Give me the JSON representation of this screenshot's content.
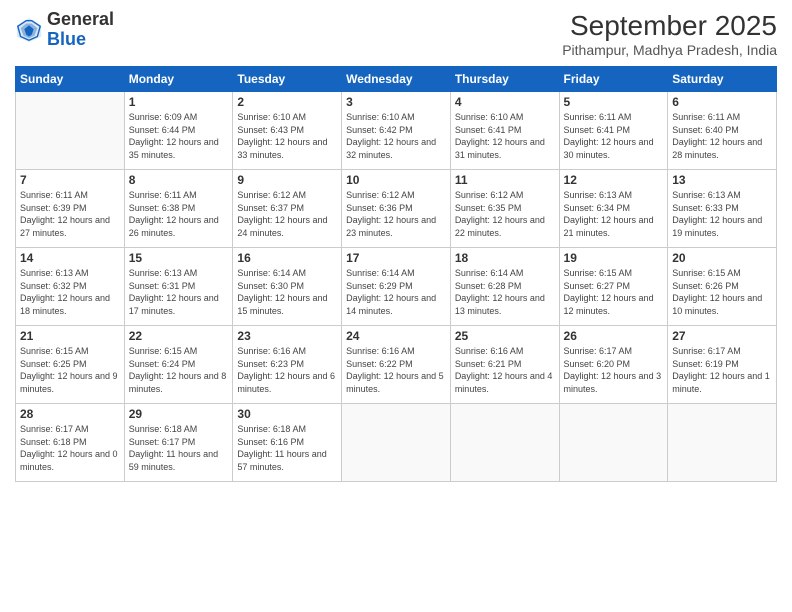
{
  "logo": {
    "general": "General",
    "blue": "Blue"
  },
  "header": {
    "month": "September 2025",
    "location": "Pithampur, Madhya Pradesh, India"
  },
  "days_of_week": [
    "Sunday",
    "Monday",
    "Tuesday",
    "Wednesday",
    "Thursday",
    "Friday",
    "Saturday"
  ],
  "weeks": [
    [
      {
        "day": "",
        "info": ""
      },
      {
        "day": "1",
        "info": "Sunrise: 6:09 AM\nSunset: 6:44 PM\nDaylight: 12 hours\nand 35 minutes."
      },
      {
        "day": "2",
        "info": "Sunrise: 6:10 AM\nSunset: 6:43 PM\nDaylight: 12 hours\nand 33 minutes."
      },
      {
        "day": "3",
        "info": "Sunrise: 6:10 AM\nSunset: 6:42 PM\nDaylight: 12 hours\nand 32 minutes."
      },
      {
        "day": "4",
        "info": "Sunrise: 6:10 AM\nSunset: 6:41 PM\nDaylight: 12 hours\nand 31 minutes."
      },
      {
        "day": "5",
        "info": "Sunrise: 6:11 AM\nSunset: 6:41 PM\nDaylight: 12 hours\nand 30 minutes."
      },
      {
        "day": "6",
        "info": "Sunrise: 6:11 AM\nSunset: 6:40 PM\nDaylight: 12 hours\nand 28 minutes."
      }
    ],
    [
      {
        "day": "7",
        "info": "Sunrise: 6:11 AM\nSunset: 6:39 PM\nDaylight: 12 hours\nand 27 minutes."
      },
      {
        "day": "8",
        "info": "Sunrise: 6:11 AM\nSunset: 6:38 PM\nDaylight: 12 hours\nand 26 minutes."
      },
      {
        "day": "9",
        "info": "Sunrise: 6:12 AM\nSunset: 6:37 PM\nDaylight: 12 hours\nand 24 minutes."
      },
      {
        "day": "10",
        "info": "Sunrise: 6:12 AM\nSunset: 6:36 PM\nDaylight: 12 hours\nand 23 minutes."
      },
      {
        "day": "11",
        "info": "Sunrise: 6:12 AM\nSunset: 6:35 PM\nDaylight: 12 hours\nand 22 minutes."
      },
      {
        "day": "12",
        "info": "Sunrise: 6:13 AM\nSunset: 6:34 PM\nDaylight: 12 hours\nand 21 minutes."
      },
      {
        "day": "13",
        "info": "Sunrise: 6:13 AM\nSunset: 6:33 PM\nDaylight: 12 hours\nand 19 minutes."
      }
    ],
    [
      {
        "day": "14",
        "info": "Sunrise: 6:13 AM\nSunset: 6:32 PM\nDaylight: 12 hours\nand 18 minutes."
      },
      {
        "day": "15",
        "info": "Sunrise: 6:13 AM\nSunset: 6:31 PM\nDaylight: 12 hours\nand 17 minutes."
      },
      {
        "day": "16",
        "info": "Sunrise: 6:14 AM\nSunset: 6:30 PM\nDaylight: 12 hours\nand 15 minutes."
      },
      {
        "day": "17",
        "info": "Sunrise: 6:14 AM\nSunset: 6:29 PM\nDaylight: 12 hours\nand 14 minutes."
      },
      {
        "day": "18",
        "info": "Sunrise: 6:14 AM\nSunset: 6:28 PM\nDaylight: 12 hours\nand 13 minutes."
      },
      {
        "day": "19",
        "info": "Sunrise: 6:15 AM\nSunset: 6:27 PM\nDaylight: 12 hours\nand 12 minutes."
      },
      {
        "day": "20",
        "info": "Sunrise: 6:15 AM\nSunset: 6:26 PM\nDaylight: 12 hours\nand 10 minutes."
      }
    ],
    [
      {
        "day": "21",
        "info": "Sunrise: 6:15 AM\nSunset: 6:25 PM\nDaylight: 12 hours\nand 9 minutes."
      },
      {
        "day": "22",
        "info": "Sunrise: 6:15 AM\nSunset: 6:24 PM\nDaylight: 12 hours\nand 8 minutes."
      },
      {
        "day": "23",
        "info": "Sunrise: 6:16 AM\nSunset: 6:23 PM\nDaylight: 12 hours\nand 6 minutes."
      },
      {
        "day": "24",
        "info": "Sunrise: 6:16 AM\nSunset: 6:22 PM\nDaylight: 12 hours\nand 5 minutes."
      },
      {
        "day": "25",
        "info": "Sunrise: 6:16 AM\nSunset: 6:21 PM\nDaylight: 12 hours\nand 4 minutes."
      },
      {
        "day": "26",
        "info": "Sunrise: 6:17 AM\nSunset: 6:20 PM\nDaylight: 12 hours\nand 3 minutes."
      },
      {
        "day": "27",
        "info": "Sunrise: 6:17 AM\nSunset: 6:19 PM\nDaylight: 12 hours\nand 1 minute."
      }
    ],
    [
      {
        "day": "28",
        "info": "Sunrise: 6:17 AM\nSunset: 6:18 PM\nDaylight: 12 hours\nand 0 minutes."
      },
      {
        "day": "29",
        "info": "Sunrise: 6:18 AM\nSunset: 6:17 PM\nDaylight: 11 hours\nand 59 minutes."
      },
      {
        "day": "30",
        "info": "Sunrise: 6:18 AM\nSunset: 6:16 PM\nDaylight: 11 hours\nand 57 minutes."
      },
      {
        "day": "",
        "info": ""
      },
      {
        "day": "",
        "info": ""
      },
      {
        "day": "",
        "info": ""
      },
      {
        "day": "",
        "info": ""
      }
    ]
  ]
}
